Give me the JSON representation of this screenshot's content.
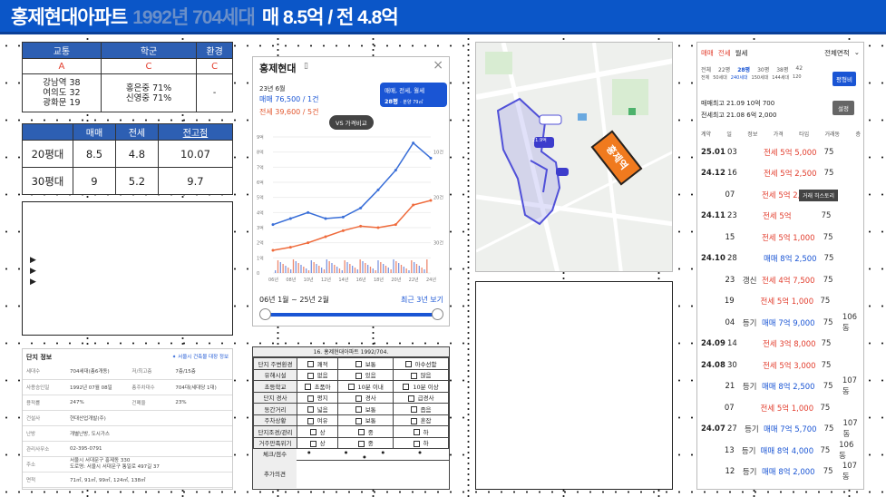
{
  "title": {
    "part1": "홍제현대아파트",
    "part2": "1992년 704세대",
    "part3": "매 8.5억 / 전 4.8억"
  },
  "infra": {
    "headers": [
      "교통",
      "학군",
      "환경"
    ],
    "grades": [
      "A",
      "C",
      "C"
    ],
    "transport": "강남역 38\n여의도 32\n광화문 19",
    "school": "홍은중 71%\n신영중 71%",
    "env": "-"
  },
  "price_table": {
    "headers": [
      "",
      "매매",
      "전세",
      "전고점"
    ],
    "rows": [
      [
        "20평대",
        "8.5",
        "4.8",
        "10.07"
      ],
      [
        "30평대",
        "9",
        "5.2",
        "9.7"
      ]
    ]
  },
  "arrows": [
    "▶",
    "▶",
    "▶"
  ],
  "complex_info": {
    "title": "단지 정보",
    "link": "✦ 서울시 건축물 대장 정보",
    "rows": [
      [
        "세대수",
        "704세대(총6개동)",
        "저/최고층",
        "7층/15층"
      ],
      [
        "사용승인일",
        "1992년 07월 08일",
        "총주차대수",
        "704대(세대당 1대)"
      ],
      [
        "용적률",
        "247%",
        "건폐율",
        "23%"
      ],
      [
        "건설사",
        "현대산업개발(주)",
        "",
        ""
      ],
      [
        "난방",
        "개별난방, 도시가스",
        "",
        ""
      ],
      [
        "관리사무소",
        "02-395-0791",
        "",
        ""
      ],
      [
        "주소",
        "서울시 서대문구 홍제동 330\n도로명: 서울시 서대문구 통일로 497길 37",
        "",
        ""
      ],
      [
        "면적",
        "71㎡, 91㎡, 99㎡, 124㎡, 138㎡",
        "",
        ""
      ]
    ]
  },
  "chart": {
    "name": "홍제현대",
    "date": "23년 6월",
    "sale": "매매 76,500 / 1건",
    "lease": "전세 39,600 / 5건",
    "vs": "VS 가격비교",
    "filter": "매매, 전세, 월세",
    "size": "28평",
    "size_sub": "· 분양 79㎡",
    "range": "06년 1월 ~ 25년 2월",
    "recent": "최근 3년 보기",
    "y_left": [
      "9억",
      "8억",
      "7억",
      "6억",
      "5억",
      "4억",
      "3억",
      "2억",
      "1억",
      "0"
    ],
    "y_right": [
      "",
      "10건",
      "",
      "",
      "20건",
      "",
      "",
      "30건",
      "",
      ""
    ],
    "x": [
      "06년",
      "08년",
      "10년",
      "12년",
      "14년",
      "16년",
      "18년",
      "20년",
      "22년",
      "24년"
    ]
  },
  "chart_data": {
    "type": "line",
    "x": [
      "06년",
      "08년",
      "10년",
      "12년",
      "14년",
      "16년",
      "18년",
      "20년",
      "22년",
      "24년"
    ],
    "series": [
      {
        "name": "매매",
        "values": [
          3.2,
          3.6,
          4.0,
          3.6,
          3.7,
          4.3,
          5.5,
          6.8,
          8.6,
          7.6
        ]
      },
      {
        "name": "전세",
        "values": [
          1.5,
          1.7,
          2.0,
          2.4,
          2.8,
          3.1,
          3.0,
          3.2,
          4.5,
          4.8
        ]
      }
    ],
    "ylim": [
      0,
      9
    ]
  },
  "map": {
    "label": "홍제역",
    "markers": [
      "21.9억",
      "매물",
      "지도"
    ]
  },
  "checklist": {
    "title": "16. 홍제현대아파트 1992/704.",
    "rows": [
      [
        "단지 주변환경",
        "쾌적",
        "보통",
        "아수선함"
      ],
      [
        "유해시설",
        "없음",
        "있음",
        "많음"
      ],
      [
        "초등학교",
        "초품아",
        "10분 이내",
        "10분 이상"
      ],
      [
        "단지 경사",
        "평지",
        "경사",
        "급경사"
      ],
      [
        "동간거리",
        "넓음",
        "보통",
        "좁음"
      ],
      [
        "주차상황",
        "여유",
        "보통",
        "혼잡"
      ],
      [
        "단지조경/관리",
        "상",
        "중",
        "하"
      ],
      [
        "거주만족위기",
        "상",
        "중",
        "하"
      ]
    ],
    "rating_label": "체크/점수",
    "rating": "● ● ● ● ●",
    "note_label": "추가의견"
  },
  "listing": {
    "tabs": [
      "매매",
      "전세",
      "월세"
    ],
    "all": "전체면적",
    "sizes": [
      [
        "전체",
        "22평",
        "28평",
        "30평",
        "38평",
        "42"
      ],
      [
        "전체",
        "50세대",
        "240세대",
        "150세대",
        "144세대",
        "120"
      ]
    ],
    "compare": "평형비",
    "high1": "매매최고 21.09 10억 700",
    "high2": "전세최고 21.08 6억 2,000",
    "setting": "설정",
    "cols": [
      "계약",
      "일",
      "정보",
      "가격",
      "타입",
      "거래동",
      "층"
    ],
    "tooltip": "거래 히스토리",
    "rows": [
      [
        "25.01",
        "03",
        "",
        "전세 5억 5,000",
        "75",
        "",
        "3층"
      ],
      [
        "24.12",
        "16",
        "",
        "전세 5억 2,500",
        "75",
        "",
        "6층"
      ],
      [
        "",
        "07",
        "",
        "전세 5억 2,000",
        "75",
        "",
        "1층"
      ],
      [
        "24.11",
        "23",
        "",
        "전세 5억",
        "75",
        "",
        "11층"
      ],
      [
        "",
        "15",
        "",
        "전세 5억 1,000",
        "75",
        "",
        "8층"
      ],
      [
        "24.10",
        "28",
        "",
        "매매 8억 2,500",
        "75",
        "",
        "5층"
      ],
      [
        "",
        "23",
        "갱신",
        "전세 4억 7,500",
        "75",
        "",
        "8층"
      ],
      [
        "",
        "19",
        "",
        "전세 5억 1,000",
        "75",
        "",
        "12층"
      ],
      [
        "",
        "04",
        "등기",
        "매매 7억 9,000",
        "75",
        "106동",
        "9층"
      ],
      [
        "24.09",
        "14",
        "",
        "전세 3억 8,000",
        "75",
        "",
        "13층"
      ],
      [
        "24.08",
        "30",
        "",
        "전세 5억 3,000",
        "75",
        "",
        "11층"
      ],
      [
        "",
        "21",
        "등기",
        "매매 8억 2,500",
        "75",
        "107동",
        "6층"
      ],
      [
        "",
        "07",
        "",
        "전세 5억 1,000",
        "75",
        "",
        "14층"
      ],
      [
        "24.07",
        "27",
        "등기",
        "매매 7억 5,700",
        "75",
        "107동",
        "1층"
      ],
      [
        "",
        "13",
        "등기",
        "매매 8억 4,000",
        "75",
        "106동",
        "11층"
      ],
      [
        "",
        "12",
        "등기",
        "매매 8억 2,000",
        "75",
        "107동",
        "3층"
      ]
    ]
  }
}
